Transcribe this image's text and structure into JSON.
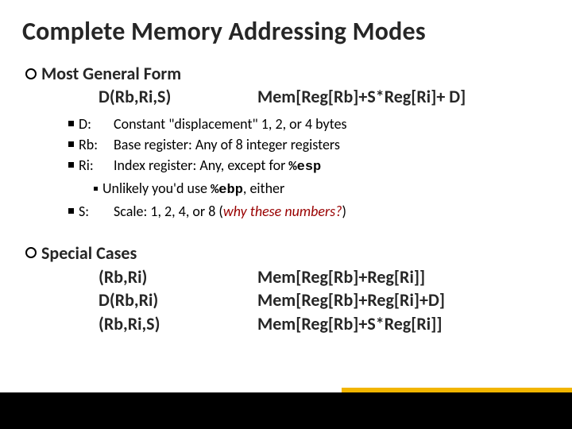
{
  "title": "Complete Memory Addressing Modes",
  "general": {
    "heading": "Most General Form",
    "form_left": "D(Rb,Ri,S)",
    "form_right": "Mem[Reg[Rb]+S*Reg[Ri]+ D]",
    "defs": {
      "d_term": "D:",
      "d_desc": "Constant \"displacement\" 1, 2, or 4 bytes",
      "rb_term": "Rb:",
      "rb_desc": "Base register: Any of 8 integer registers",
      "ri_term": "Ri:",
      "ri_desc_a": "Index register: Any, except for ",
      "ri_code": "%esp",
      "sub_a": "Unlikely you'd use ",
      "sub_code": "%ebp",
      "sub_b": ", either",
      "s_term": "S:",
      "s_desc_a": "Scale: 1, 2, 4, or 8 (",
      "s_desc_b": "why these numbers?",
      "s_desc_c": ")"
    }
  },
  "special": {
    "heading": "Special Cases",
    "rows": [
      {
        "left": "(Rb,Ri)",
        "right": "Mem[Reg[Rb]+Reg[Ri]]"
      },
      {
        "left": "D(Rb,Ri)",
        "right": "Mem[Reg[Rb]+Reg[Ri]+D]"
      },
      {
        "left": "(Rb,Ri,S)",
        "right": "Mem[Reg[Rb]+S*Reg[Ri]]"
      }
    ]
  }
}
